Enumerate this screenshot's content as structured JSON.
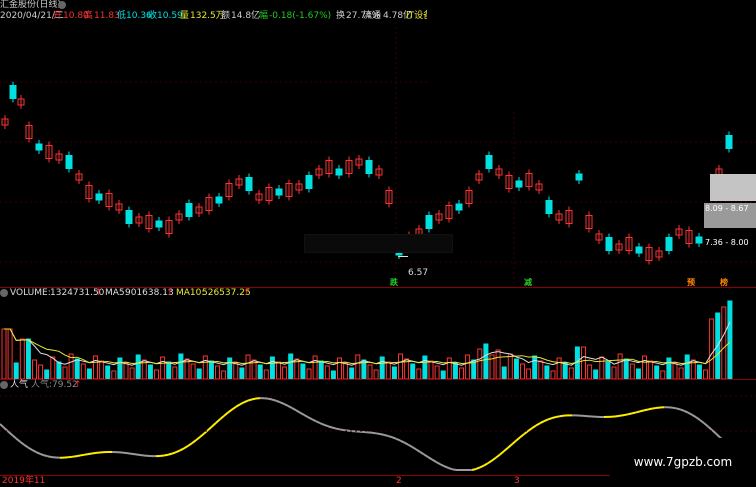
{
  "header": {
    "title": "汇金股份(日线)",
    "date": "2020/04/21/二",
    "open_label": "开",
    "open": "10.80",
    "high_label": "高",
    "high": "11.83",
    "low_label": "低",
    "low": "10.36",
    "close_label": "收",
    "close": "10.59",
    "volume_label": "量",
    "volume": "132.5万",
    "amount_label": "额",
    "amount": "14.8亿",
    "change_label": "幅",
    "change": "-0.18(-1.67%)",
    "turnover_label": "换",
    "turnover": "27.74%",
    "float_label": "流通",
    "float": "4.78亿",
    "sector": "IT设备"
  },
  "main": {
    "low_marker": "6.57",
    "range_upper": "8.09 - 8.67",
    "range_lower": "7.36 - 8.00",
    "tags": [
      {
        "text": "跌",
        "color": "#22cc22"
      },
      {
        "text": "减",
        "color": "#22cc22"
      },
      {
        "text": "预",
        "color": "#ff8800"
      },
      {
        "text": "榜",
        "color": "#ff8800"
      }
    ]
  },
  "volume_panel": {
    "label": "VOLUME:",
    "value": "1324731.50",
    "ma5_label": "MA5:",
    "ma5": "901638.13",
    "ma10_label": "MA10:",
    "ma10": "526537.25"
  },
  "popularity_panel": {
    "label": "人气",
    "label2": "人气:",
    "value": "79.52"
  },
  "xaxis": {
    "left_label": "2019年11",
    "tick2": "2",
    "tick3": "3"
  },
  "watermark": "www.7gpzb.com",
  "colors": {
    "up": "#ff3232",
    "down": "#00e0e0",
    "ma_white": "#e0e0e0",
    "ma_yellow": "#e8e832",
    "pop_yellow": "#ffee00",
    "pop_grey": "#9a9a9a"
  }
}
